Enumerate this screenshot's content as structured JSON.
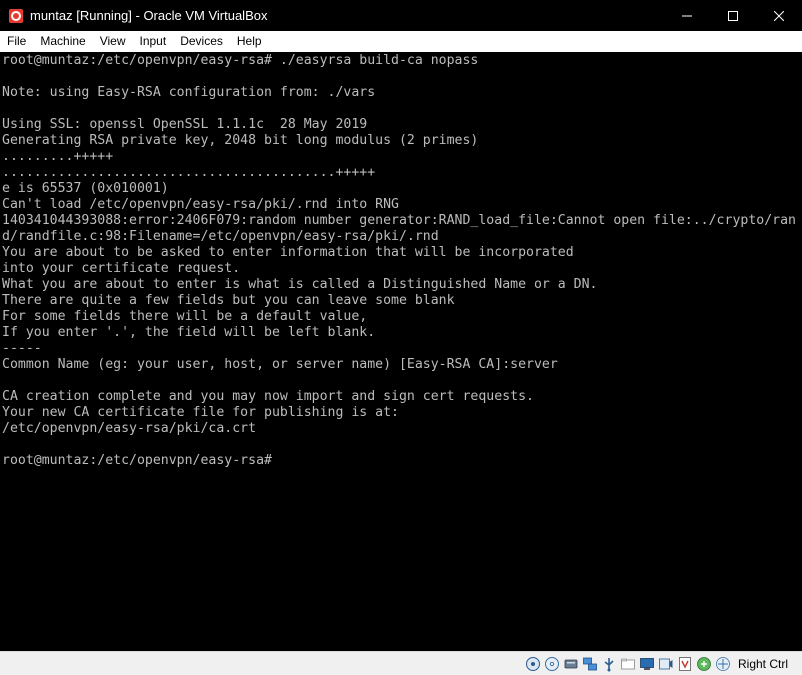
{
  "window": {
    "title": "muntaz [Running] - Oracle VM VirtualBox"
  },
  "menu": [
    "File",
    "Machine",
    "View",
    "Input",
    "Devices",
    "Help"
  ],
  "console_lines": [
    "root@muntaz:/etc/openvpn/easy-rsa# ./easyrsa build-ca nopass",
    "",
    "Note: using Easy-RSA configuration from: ./vars",
    "",
    "Using SSL: openssl OpenSSL 1.1.1c  28 May 2019",
    "Generating RSA private key, 2048 bit long modulus (2 primes)",
    ".........+++++",
    "..........................................+++++",
    "e is 65537 (0x010001)",
    "Can't load /etc/openvpn/easy-rsa/pki/.rnd into RNG",
    "140341044393088:error:2406F079:random number generator:RAND_load_file:Cannot open file:../crypto/ran",
    "d/randfile.c:98:Filename=/etc/openvpn/easy-rsa/pki/.rnd",
    "You are about to be asked to enter information that will be incorporated",
    "into your certificate request.",
    "What you are about to enter is what is called a Distinguished Name or a DN.",
    "There are quite a few fields but you can leave some blank",
    "For some fields there will be a default value,",
    "If you enter '.', the field will be left blank.",
    "-----",
    "Common Name (eg: your user, host, or server name) [Easy-RSA CA]:server",
    "",
    "CA creation complete and you may now import and sign cert requests.",
    "Your new CA certificate file for publishing is at:",
    "/etc/openvpn/easy-rsa/pki/ca.crt",
    "",
    "root@muntaz:/etc/openvpn/easy-rsa#"
  ],
  "status": {
    "host_key": "Right Ctrl",
    "icons": [
      "hard-disk-icon",
      "optical-drive-icon",
      "audio-icon",
      "network-icon",
      "usb-icon",
      "shared-folders-icon",
      "display-icon",
      "video-capture-icon",
      "virtualization-icon",
      "mouse-integration-icon",
      "keyboard-icon"
    ]
  }
}
